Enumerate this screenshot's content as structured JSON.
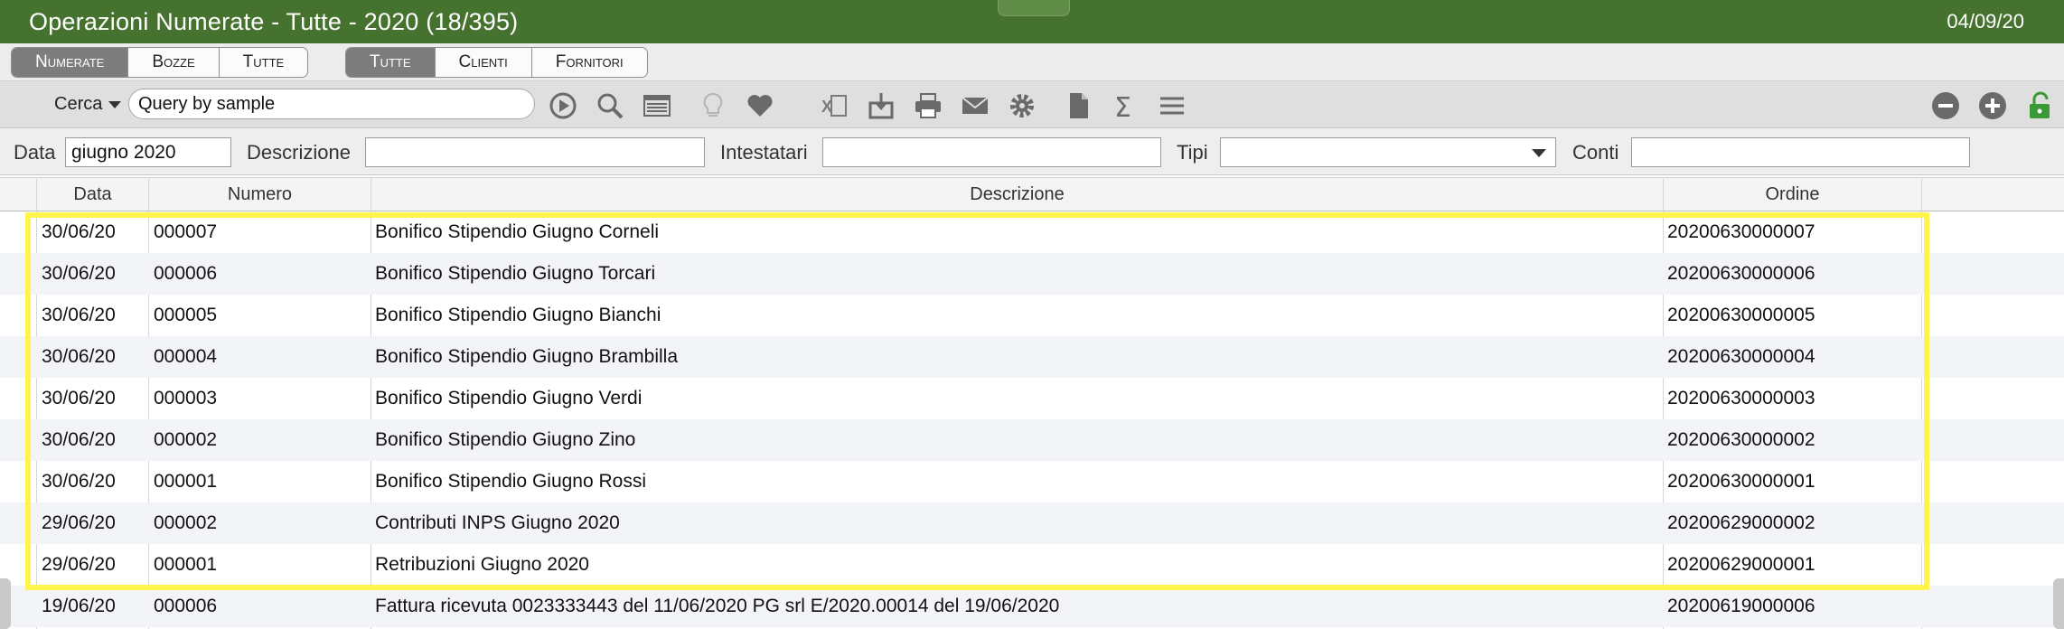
{
  "window": {
    "title": "Operazioni Numerate - Tutte - 2020 (18/395)",
    "date": "04/09/20"
  },
  "segments_left": [
    "Numerate",
    "Bozze",
    "Tutte"
  ],
  "segments_right": [
    "Tutte",
    "Clienti",
    "Fornitori"
  ],
  "search": {
    "label": "Cerca",
    "value": "Query by sample"
  },
  "filters": {
    "data_label": "Data",
    "data_value": "giugno 2020",
    "descrizione_label": "Descrizione",
    "descrizione_value": "",
    "intestatari_label": "Intestatari",
    "intestatari_value": "",
    "tipi_label": "Tipi",
    "tipi_value": "",
    "conti_label": "Conti",
    "conti_value": ""
  },
  "table": {
    "columns": [
      "Data",
      "Numero",
      "Descrizione",
      "Ordine"
    ],
    "rows": [
      [
        "30/06/20",
        "000007",
        "Bonifico Stipendio Giugno Corneli",
        "20200630000007"
      ],
      [
        "30/06/20",
        "000006",
        "Bonifico Stipendio Giugno Torcari",
        "20200630000006"
      ],
      [
        "30/06/20",
        "000005",
        "Bonifico Stipendio Giugno Bianchi",
        "20200630000005"
      ],
      [
        "30/06/20",
        "000004",
        "Bonifico Stipendio Giugno Brambilla",
        "20200630000004"
      ],
      [
        "30/06/20",
        "000003",
        "Bonifico Stipendio Giugno Verdi",
        "20200630000003"
      ],
      [
        "30/06/20",
        "000002",
        "Bonifico Stipendio Giugno Zino",
        "20200630000002"
      ],
      [
        "30/06/20",
        "000001",
        "Bonifico Stipendio Giugno Rossi",
        "20200630000001"
      ],
      [
        "29/06/20",
        "000002",
        "Contributi INPS Giugno 2020",
        "20200629000002"
      ],
      [
        "29/06/20",
        "000001",
        "Retribuzioni Giugno 2020",
        "20200629000001"
      ],
      [
        "19/06/20",
        "000006",
        "Fattura ricevuta 0023333443 del 11/06/2020 PG srl E/2020.00014 del 19/06/2020",
        "20200619000006"
      ]
    ]
  },
  "colors": {
    "titlebar": "#46722f",
    "highlight": "#fff44c",
    "active_segment": "#7d7d7d"
  },
  "toolbar_icons": [
    "play-icon",
    "search-icon",
    "list-view-icon",
    "lightbulb-icon",
    "heart-icon",
    "excel-icon",
    "download-icon",
    "print-icon",
    "mail-icon",
    "gear-icon",
    "document-icon",
    "sigma-icon",
    "menu-icon",
    "minus-icon",
    "plus-icon",
    "lock-icon"
  ]
}
